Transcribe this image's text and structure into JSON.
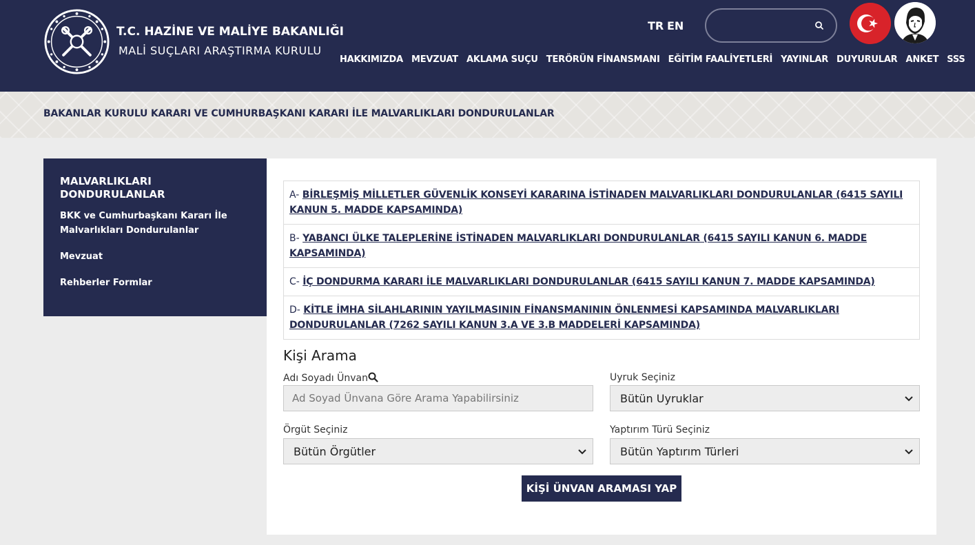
{
  "header": {
    "brand_line1": "T.C. HAZİNE VE MALİYE BAKANLIĞI",
    "brand_line2": "MALİ SUÇLARI ARAŞTIRMA KURULU",
    "lang_tr": "TR",
    "lang_en": "EN",
    "search_placeholder": "",
    "nav": [
      "HAKKIMIZDA",
      "MEVZUAT",
      "AKLAMA SUÇU",
      "TERÖRÜN FİNANSMANI",
      "EĞİTİM FAALİYETLERİ",
      "YAYINLAR",
      "DUYURULAR",
      "ANKET",
      "SSS"
    ]
  },
  "page_title": "BAKANLAR KURULU KARARI VE CUMHURBAŞKANI KARARI İLE MALVARLIKLARI DONDURULANLAR",
  "sidebar": {
    "heading": "MALVARLIKLARI DONDURULANLAR",
    "items": [
      "BKK ve Cumhurbaşkanı Kararı İle Malvarlıkları Dondurulanlar",
      "Mevzuat",
      "Rehberler Formlar"
    ]
  },
  "links": [
    {
      "prefix": "A- ",
      "text": "BİRLEŞMİŞ MİLLETLER GÜVENLİK KONSEYİ KARARINA İSTİNADEN MALVARLIKLARI DONDURULANLAR (6415 SAYILI KANUN 5. MADDE KAPSAMINDA)"
    },
    {
      "prefix": "B- ",
      "text": "YABANCI ÜLKE TALEPLERİNE İSTİNADEN MALVARLIKLARI DONDURULANLAR (6415 SAYILI KANUN 6. MADDE KAPSAMINDA)"
    },
    {
      "prefix": "C- ",
      "text": "İÇ DONDURMA KARARI İLE MALVARLIKLARI DONDURULANLAR (6415 SAYILI KANUN 7. MADDE KAPSAMINDA)"
    },
    {
      "prefix": "D- ",
      "text": "KİTLE İMHA SİLAHLARININ YAYILMASININ FİNANSMANININ ÖNLENMESİ KAPSAMINDA MALVARLIKLARI DONDURULANLAR (7262 SAYILI KANUN 3.A VE 3.B MADDELERİ KAPSAMINDA)"
    }
  ],
  "search": {
    "heading": "Kişi Arama",
    "name_label": "Adı Soyadı Ünvan",
    "name_placeholder": "Ad Soyad Ünvana Göre Arama Yapabilirsiniz",
    "nationality_label": "Uyruk Seçiniz",
    "nationality_value": "Bütün Uyruklar",
    "org_label": "Örgüt Seçiniz",
    "org_value": "Bütün Örgütler",
    "sanction_label": "Yaptırım Türü Seçiniz",
    "sanction_value": "Bütün Yaptırım Türleri",
    "submit_label": "KİŞİ ÜNVAN ARAMASI YAP"
  },
  "colors": {
    "navy": "#252b4f",
    "flag_red": "#d8232a",
    "background": "#ececec"
  }
}
